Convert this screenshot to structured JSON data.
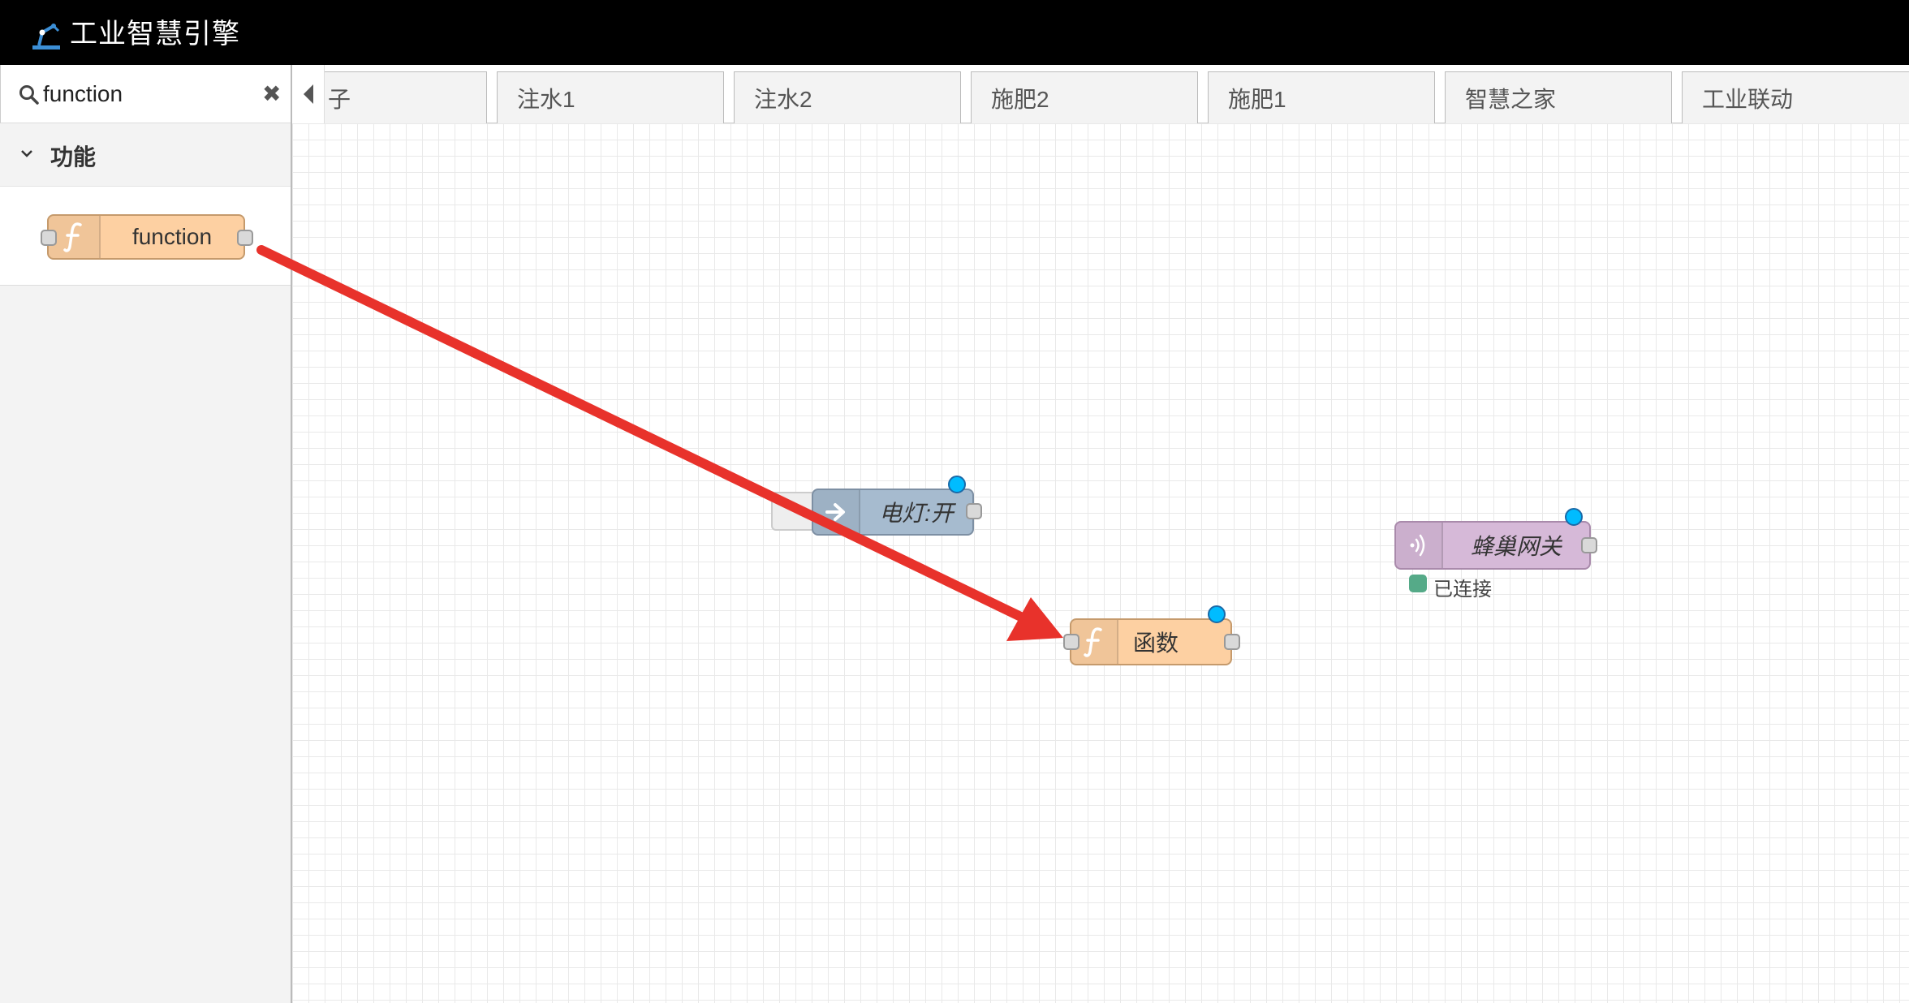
{
  "header": {
    "title": "工业智慧引擎",
    "logo_icon": "robot-arm-icon"
  },
  "palette": {
    "search": {
      "value": "function",
      "placeholder": ""
    },
    "category": {
      "label": "功能",
      "expanded": true
    },
    "nodes": [
      {
        "label": "function",
        "icon": "function-icon",
        "color": "#fdd0a2"
      }
    ]
  },
  "tabs": [
    {
      "label": "子"
    },
    {
      "label": "注水1"
    },
    {
      "label": "注水2"
    },
    {
      "label": "施肥2"
    },
    {
      "label": "施肥1"
    },
    {
      "label": "智慧之家"
    },
    {
      "label": "工业联动"
    }
  ],
  "workspace": {
    "nodes": [
      {
        "id": "link-node",
        "label": "电灯:开",
        "icon": "link-out-icon",
        "color": "#a6bbcf",
        "changed": true
      },
      {
        "id": "function-node",
        "label": "函数",
        "icon": "function-icon",
        "color": "#fdd0a2",
        "changed": true
      },
      {
        "id": "hive-node",
        "label": "蜂巢网关",
        "icon": "wireless-icon",
        "color": "#d6b9d8",
        "changed": true,
        "status": {
          "text": "已连接",
          "color": "#55aa88"
        }
      }
    ]
  },
  "annotation": {
    "type": "drag-arrow",
    "color": "#e8322b"
  }
}
